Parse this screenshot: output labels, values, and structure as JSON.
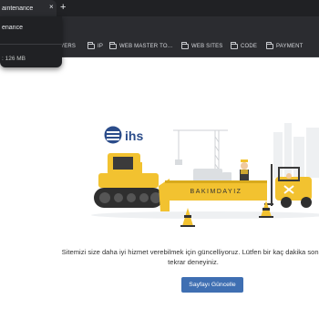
{
  "browser": {
    "tab_title": "aintenance",
    "tab_close": "×",
    "new_tab": "+",
    "hover_card": {
      "title": "enance",
      "memory": ": 126 MB"
    },
    "bookmarks": [
      {
        "label": "VERS"
      },
      {
        "label": "IP"
      },
      {
        "label": "WEB MASTER TO..."
      },
      {
        "label": "WEB SITES"
      },
      {
        "label": "CODE"
      },
      {
        "label": "PAYMENT"
      }
    ]
  },
  "page": {
    "logo_text": "ihs",
    "banner_text": "BAKIMDAYIZ",
    "message": "Sitemizi size daha iyi hizmet verebilmek için güncelliyoruz. Lütfen bir kaç dakika sonra tekrar deneyiniz.",
    "button_label": "Sayfayı Güncelle"
  },
  "colors": {
    "accent": "#3f6fb2",
    "machine_yellow": "#f2c230",
    "chrome_dark": "#202124"
  }
}
